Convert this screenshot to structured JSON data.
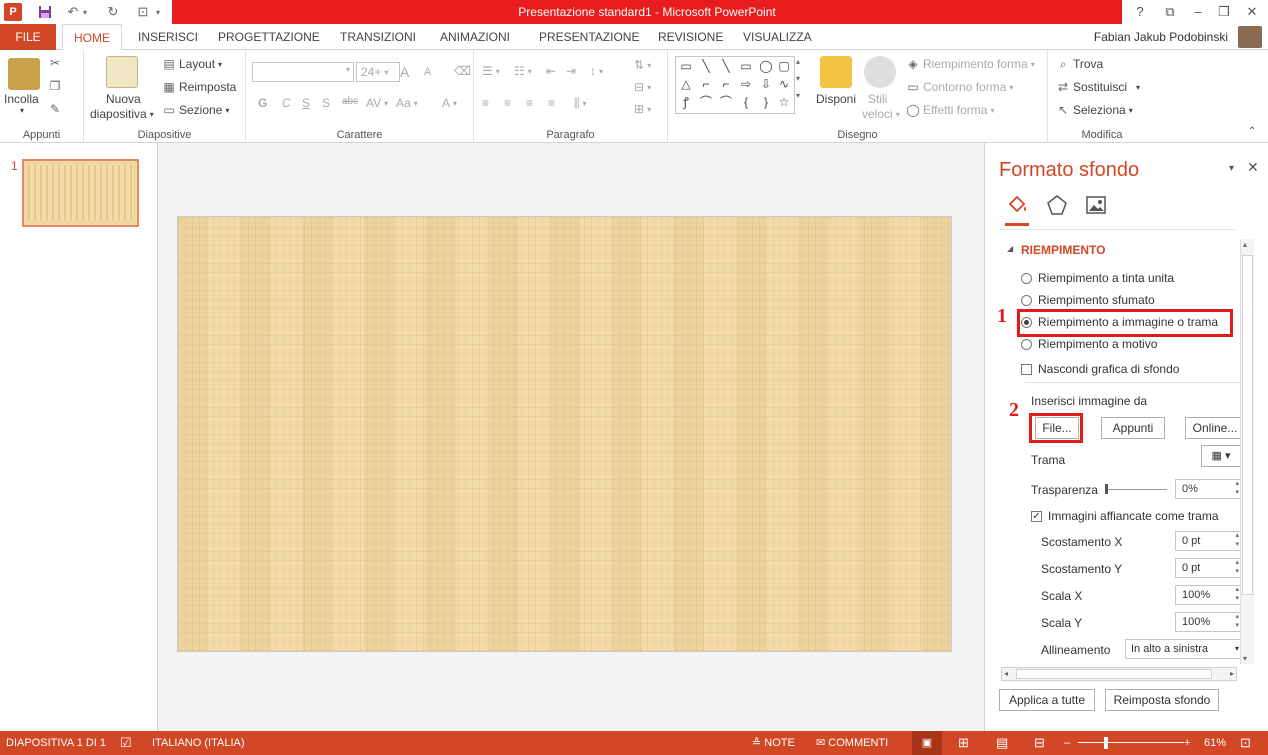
{
  "window": {
    "title": "Presentazione standard1 - Microsoft PowerPoint",
    "help": "?",
    "app_icon": "P"
  },
  "tabs": [
    "FILE",
    "HOME",
    "INSERISCI",
    "PROGETTAZIONE",
    "TRANSIZIONI",
    "ANIMAZIONI",
    "PRESENTAZIONE",
    "REVISIONE",
    "VISUALIZZA"
  ],
  "user": "Fabian Jakub Podobinski",
  "ribbon": {
    "appunti": {
      "label": "Appunti",
      "incolla": "Incolla"
    },
    "diapositive": {
      "label": "Diapositive",
      "nuova_line1": "Nuova",
      "nuova_line2": "diapositiva",
      "layout": "Layout",
      "reimposta": "Reimposta",
      "sezione": "Sezione"
    },
    "carattere": {
      "label": "Carattere",
      "font_size": "24+",
      "bold": "G",
      "italic": "C",
      "underline": "S",
      "shadow": "S",
      "strike": "abc",
      "spacing": "AV",
      "case": "Aa",
      "grow": "A",
      "shrink": "A"
    },
    "paragrafo": {
      "label": "Paragrafo"
    },
    "disegno": {
      "label": "Disegno",
      "disponi": "Disponi",
      "stili_line1": "Stili",
      "stili_line2": "veloci",
      "riempimento": "Riempimento forma",
      "contorno": "Contorno forma",
      "effetti": "Effetti forma"
    },
    "modifica": {
      "label": "Modifica",
      "trova": "Trova",
      "sostituisci": "Sostituisci",
      "seleziona": "Seleziona"
    }
  },
  "thumbnails": {
    "number": "1"
  },
  "pane": {
    "title": "Formato sfondo",
    "section": "RIEMPIMENTO",
    "options": [
      {
        "label": "Riempimento a tinta unita",
        "checked": false
      },
      {
        "label": "Riempimento sfumato",
        "checked": false
      },
      {
        "label": "Riempimento a immagine o trama",
        "checked": true
      },
      {
        "label": "Riempimento a motivo",
        "checked": false
      }
    ],
    "hide_graphics": "Nascondi grafica di sfondo",
    "insert_from": "Inserisci immagine da",
    "btn_file": "File...",
    "btn_appunti": "Appunti",
    "btn_online": "Online...",
    "trama": "Trama",
    "trasparenza": "Trasparenza",
    "trasparenza_value": "0%",
    "tile": "Immagini affiancate come trama",
    "offset_x": "Scostamento X",
    "offset_x_value": "0 pt",
    "offset_y": "Scostamento Y",
    "offset_y_value": "0 pt",
    "scale_x": "Scala X",
    "scale_x_value": "100%",
    "scale_y": "Scala Y",
    "scale_y_value": "100%",
    "align": "Allineamento",
    "align_value": "In alto a sinistra",
    "apply_all": "Applica a tutte",
    "reset": "Reimposta sfondo",
    "annotation_1": "1",
    "annotation_2": "2"
  },
  "status": {
    "slide": "DIAPOSITIVA 1 DI 1",
    "language": "ITALIANO (ITALIA)",
    "notes": "NOTE",
    "comments": "COMMENTI",
    "zoom": "61%"
  },
  "colors": {
    "accent": "#d24726",
    "titlebar": "#e81c1c",
    "annotation": "#e21a1a"
  },
  "icons": [
    "powerpoint-icon",
    "save-icon",
    "undo-icon",
    "redo-icon",
    "presentation-icon",
    "fill-bucket-icon",
    "pentagon-icon",
    "picture-icon",
    "close-icon"
  ]
}
